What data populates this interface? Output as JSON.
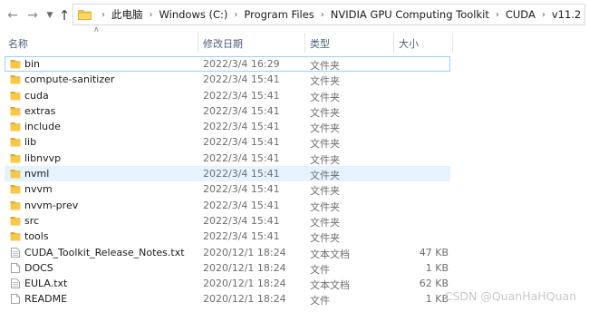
{
  "nav": {
    "back_icon": "arrow-left-icon",
    "forward_icon": "arrow-right-icon",
    "recent_icon": "chevron-down-icon",
    "up_icon": "arrow-up-icon"
  },
  "breadcrumb": [
    "此电脑",
    "Windows (C:)",
    "Program Files",
    "NVIDIA GPU Computing Toolkit",
    "CUDA",
    "v11.2"
  ],
  "columns": {
    "name": "名称",
    "date": "修改日期",
    "type": "类型",
    "size": "大小"
  },
  "colors": {
    "folder": "#f7c948",
    "folder_dark": "#e0a82e",
    "focus_border": "#99d1ff",
    "hover_bg": "#e5f3ff",
    "header_text": "#4c607a"
  },
  "files": [
    {
      "name": "bin",
      "date": "2022/3/4 16:29",
      "type": "文件夹",
      "size": "",
      "icon": "folder-icon"
    },
    {
      "name": "compute-sanitizer",
      "date": "2022/3/4 15:41",
      "type": "文件夹",
      "size": "",
      "icon": "folder-icon"
    },
    {
      "name": "cuda",
      "date": "2022/3/4 15:41",
      "type": "文件夹",
      "size": "",
      "icon": "folder-icon"
    },
    {
      "name": "extras",
      "date": "2022/3/4 15:41",
      "type": "文件夹",
      "size": "",
      "icon": "folder-icon"
    },
    {
      "name": "include",
      "date": "2022/3/4 15:41",
      "type": "文件夹",
      "size": "",
      "icon": "folder-icon"
    },
    {
      "name": "lib",
      "date": "2022/3/4 15:41",
      "type": "文件夹",
      "size": "",
      "icon": "folder-icon"
    },
    {
      "name": "libnvvp",
      "date": "2022/3/4 15:41",
      "type": "文件夹",
      "size": "",
      "icon": "folder-icon"
    },
    {
      "name": "nvml",
      "date": "2022/3/4 15:41",
      "type": "文件夹",
      "size": "",
      "icon": "folder-icon"
    },
    {
      "name": "nvvm",
      "date": "2022/3/4 15:41",
      "type": "文件夹",
      "size": "",
      "icon": "folder-icon"
    },
    {
      "name": "nvvm-prev",
      "date": "2022/3/4 15:41",
      "type": "文件夹",
      "size": "",
      "icon": "folder-icon"
    },
    {
      "name": "src",
      "date": "2022/3/4 15:41",
      "type": "文件夹",
      "size": "",
      "icon": "folder-icon"
    },
    {
      "name": "tools",
      "date": "2022/3/4 15:41",
      "type": "文件夹",
      "size": "",
      "icon": "folder-icon"
    },
    {
      "name": "CUDA_Toolkit_Release_Notes.txt",
      "date": "2020/12/1 18:24",
      "type": "文本文档",
      "size": "47 KB",
      "icon": "text-file-icon"
    },
    {
      "name": "DOCS",
      "date": "2020/12/1 18:24",
      "type": "文件",
      "size": "1 KB",
      "icon": "file-icon"
    },
    {
      "name": "EULA.txt",
      "date": "2020/12/1 18:24",
      "type": "文本文档",
      "size": "62 KB",
      "icon": "text-file-icon"
    },
    {
      "name": "README",
      "date": "2020/12/1 18:24",
      "type": "文件",
      "size": "1 KB",
      "icon": "file-icon"
    }
  ],
  "watermark": "CSDN @QuanHaHQuan"
}
